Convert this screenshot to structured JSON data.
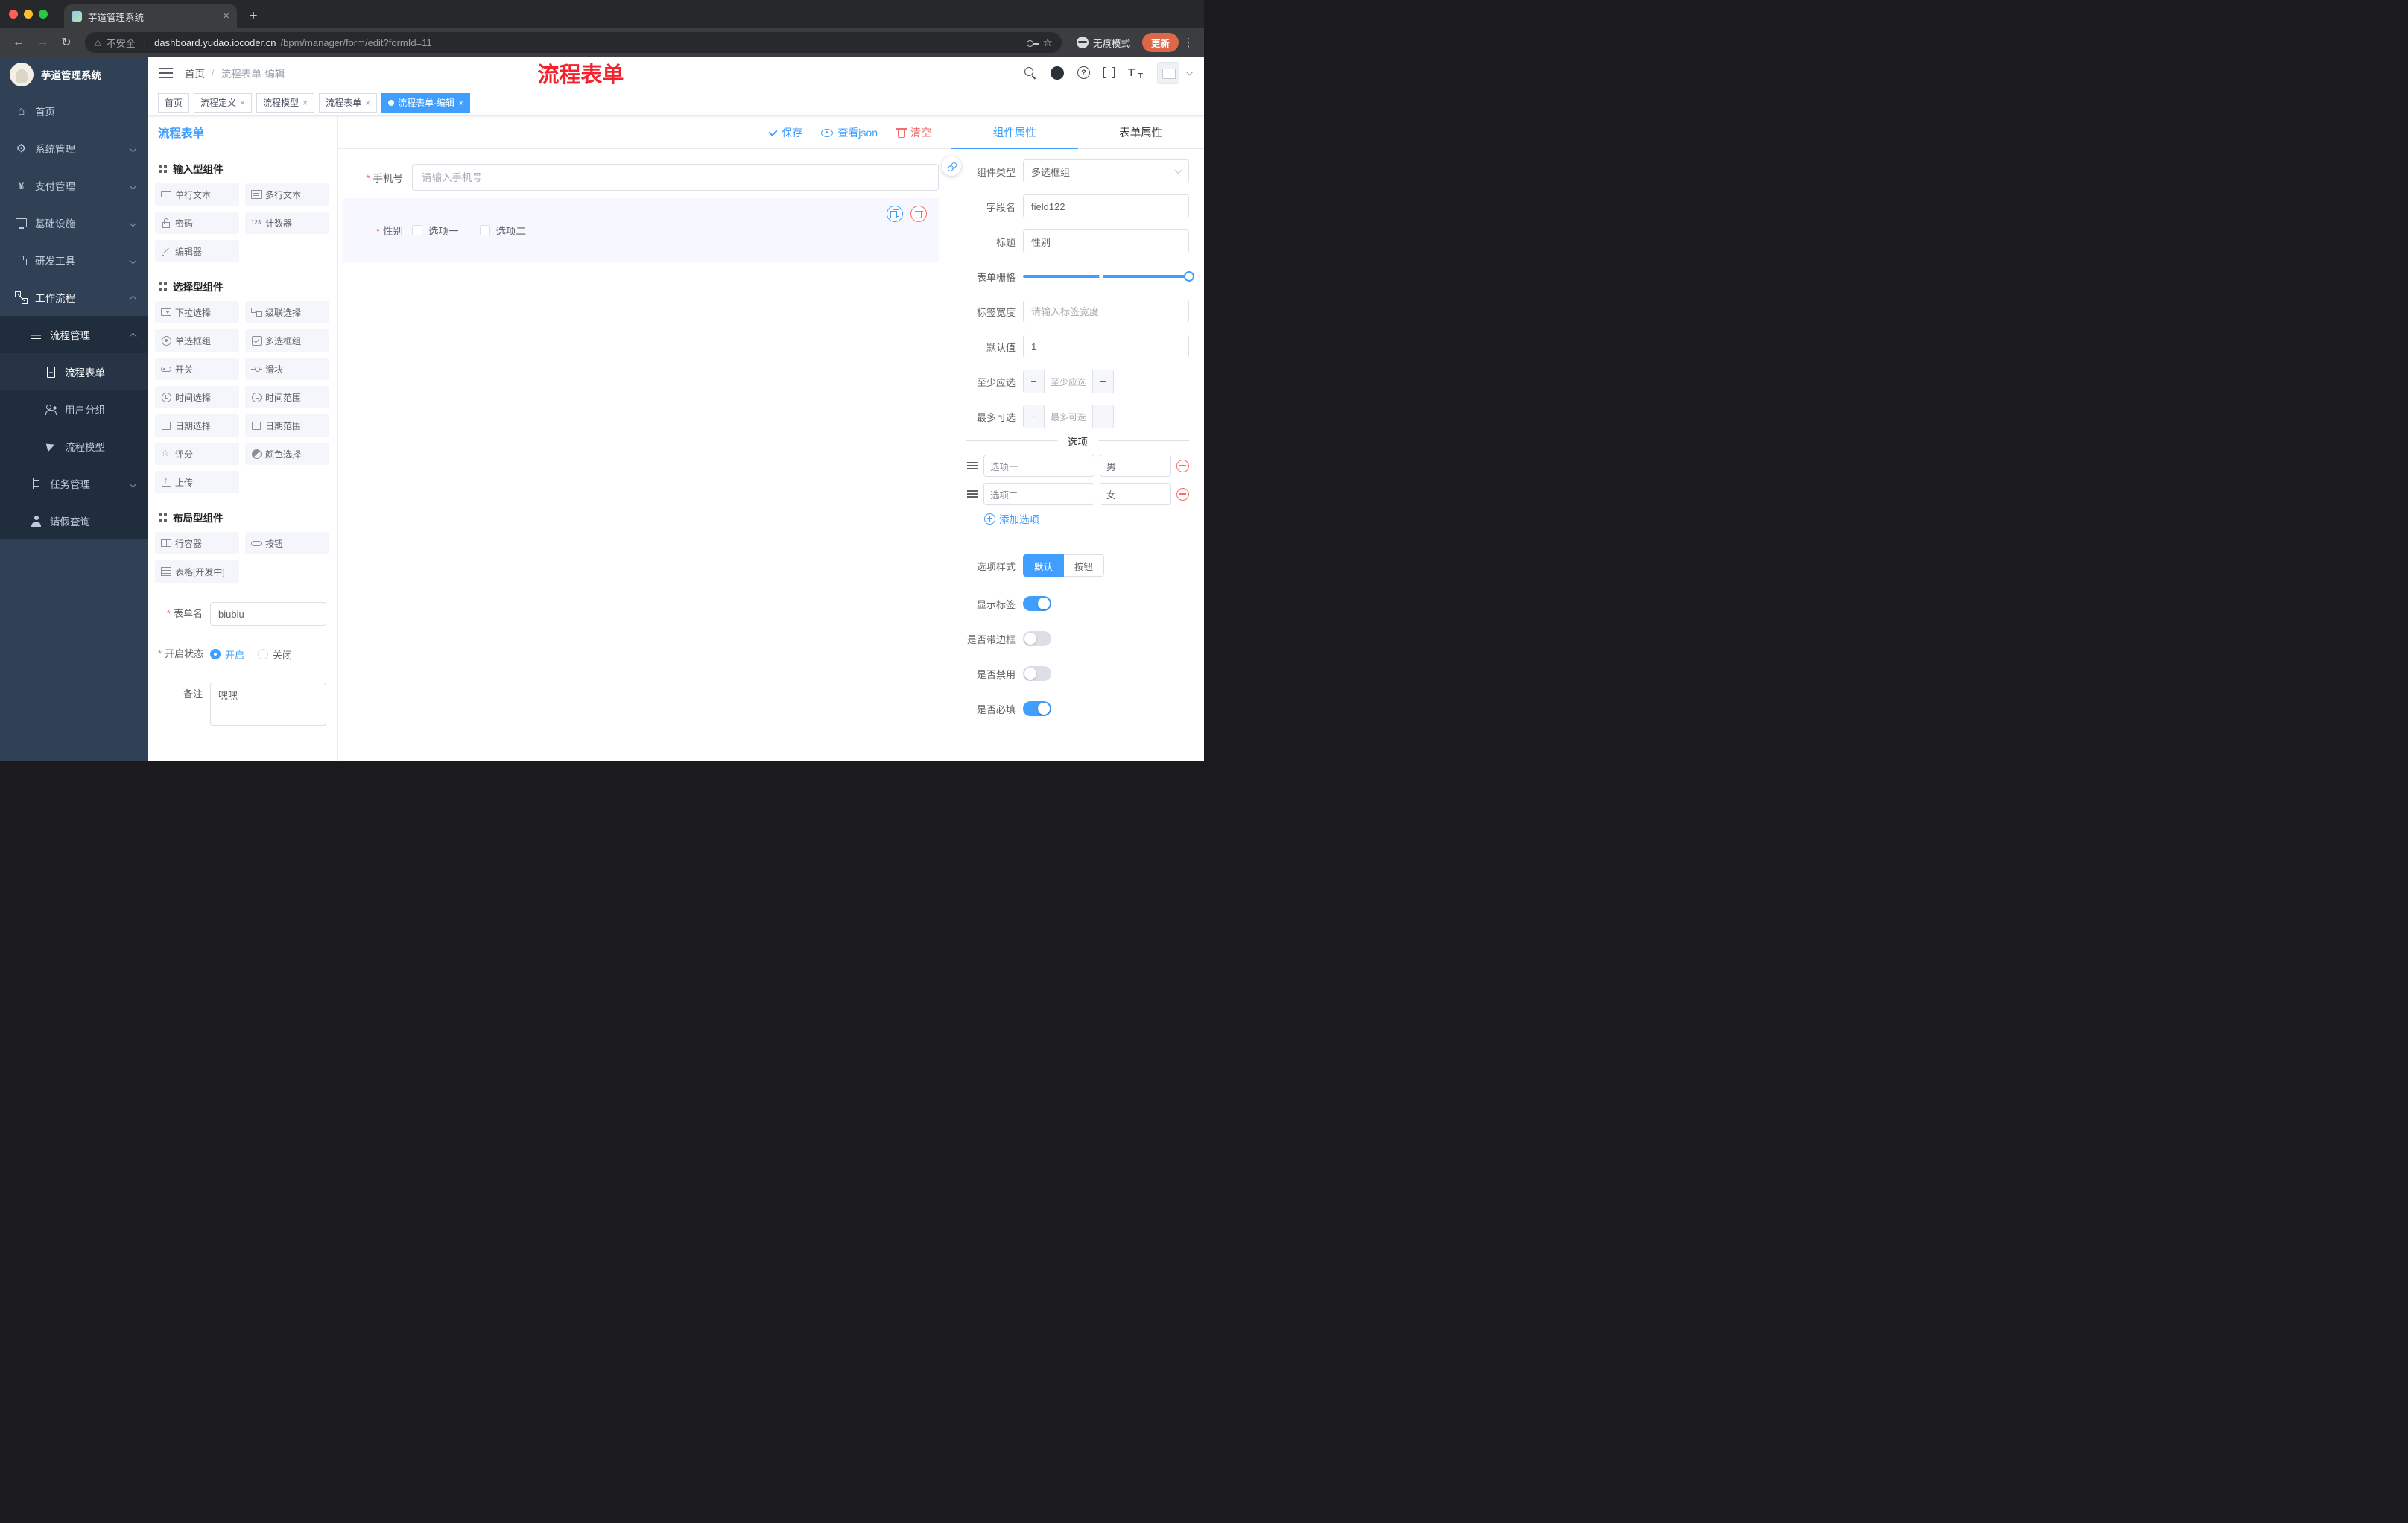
{
  "browser": {
    "tab_title": "芋道管理系统",
    "security_label": "不安全",
    "url_domain": "dashboard.yudao.iocoder.cn",
    "url_path": "/bpm/manager/form/edit?formId=11",
    "incognito_label": "无痕模式",
    "update_label": "更新"
  },
  "sidebar": {
    "logo_title": "芋道管理系统",
    "items": [
      {
        "label": "首页"
      },
      {
        "label": "系统管理"
      },
      {
        "label": "支付管理"
      },
      {
        "label": "基础设施"
      },
      {
        "label": "研发工具"
      },
      {
        "label": "工作流程"
      },
      {
        "label": "流程管理"
      },
      {
        "label": "流程表单"
      },
      {
        "label": "用户分组"
      },
      {
        "label": "流程模型"
      },
      {
        "label": "任务管理"
      },
      {
        "label": "请假查询"
      }
    ]
  },
  "header": {
    "breadcrumb_home": "首页",
    "breadcrumb_current": "流程表单-编辑",
    "annotation": "流程表单"
  },
  "tags": [
    {
      "label": "首页"
    },
    {
      "label": "流程定义"
    },
    {
      "label": "流程模型"
    },
    {
      "label": "流程表单"
    },
    {
      "label": "流程表单-编辑"
    }
  ],
  "designer": {
    "panel_title": "流程表单",
    "toolbar": {
      "save": "保存",
      "view_json": "查看json",
      "clear": "清空"
    },
    "palette": {
      "groups": [
        {
          "title": "输入型组件",
          "items": [
            "单行文本",
            "多行文本",
            "密码",
            "计数器",
            "编辑器"
          ]
        },
        {
          "title": "选择型组件",
          "items": [
            "下拉选择",
            "级联选择",
            "单选框组",
            "多选框组",
            "开关",
            "滑块",
            "时间选择",
            "时间范围",
            "日期选择",
            "日期范围",
            "评分",
            "颜色选择",
            "上传"
          ]
        },
        {
          "title": "布局型组件",
          "items": [
            "行容器",
            "按钮",
            "表格[开发中]"
          ]
        }
      ]
    },
    "meta": {
      "form_name_label": "表单名",
      "form_name_value": "biubiu",
      "status_label": "开启状态",
      "status_on": "开启",
      "status_off": "关闭",
      "remark_label": "备注",
      "remark_value": "嘿嘿"
    },
    "canvas": {
      "phone_label": "手机号",
      "phone_placeholder": "请输入手机号",
      "gender_label": "性别",
      "gender_option1": "选项一",
      "gender_option2": "选项二"
    }
  },
  "properties": {
    "tab_component": "组件属性",
    "tab_form": "表单属性",
    "component_type_label": "组件类型",
    "component_type_value": "多选框组",
    "field_name_label": "字段名",
    "field_name_value": "field122",
    "title_label": "标题",
    "title_value": "性别",
    "grid_label": "表单栅格",
    "label_width_label": "标签宽度",
    "label_width_placeholder": "请输入标签宽度",
    "default_label": "默认值",
    "default_value": "1",
    "min_label": "至少应选",
    "min_placeholder": "至少应选",
    "max_label": "最多可选",
    "max_placeholder": "最多可选",
    "options_divider": "选项",
    "options": [
      {
        "label": "选项一",
        "value": "男"
      },
      {
        "label": "选项二",
        "value": "女"
      }
    ],
    "add_option": "添加选项",
    "option_style_label": "选项样式",
    "option_style_default": "默认",
    "option_style_button": "按钮",
    "show_label_label": "显示标签",
    "border_label": "是否带边框",
    "disabled_label": "是否禁用",
    "required_label": "是否必填"
  },
  "colors": {
    "accent": "#409eff",
    "danger": "#f56c6c",
    "annotation_red": "#f5222d",
    "sidebar_bg": "#304156",
    "sidebar_submenu_bg": "#1f2d3d",
    "selected_block_bg": "#f6f7ff"
  }
}
